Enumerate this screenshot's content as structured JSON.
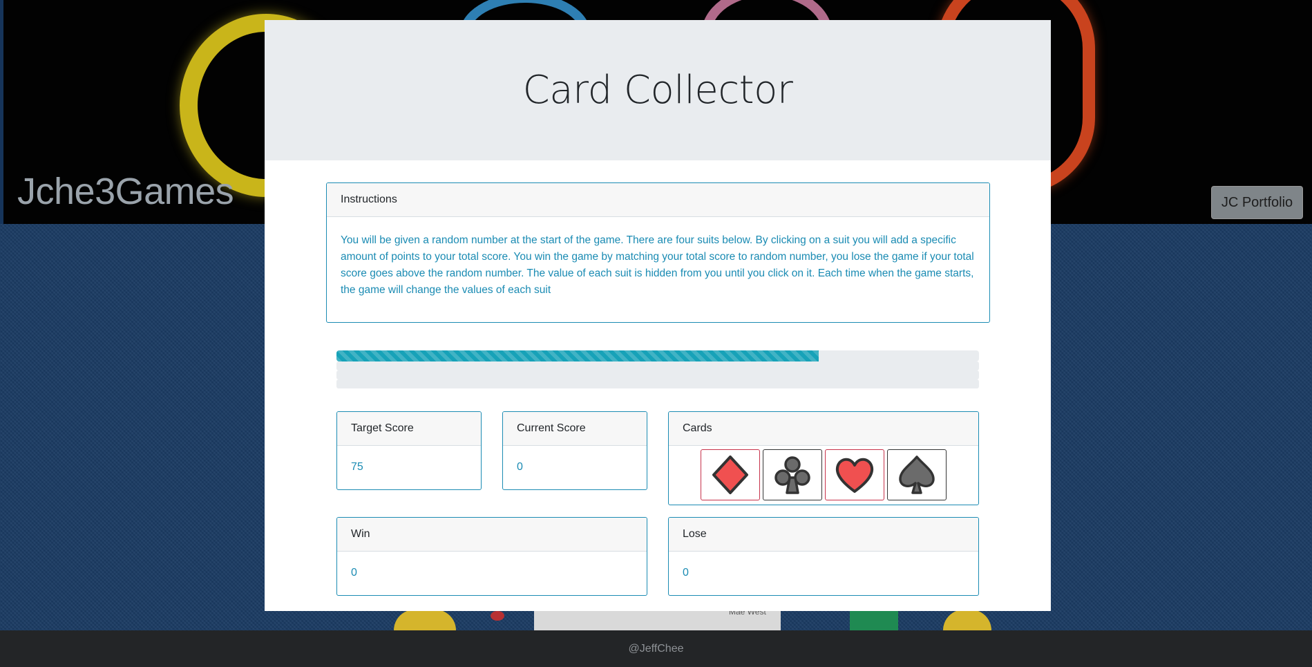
{
  "site": {
    "brand": "Jche3Games",
    "portfolio_button": "JC Portfolio",
    "footer": "@JeffChee",
    "decor_text": "Mae West"
  },
  "game": {
    "title": "Card Collector",
    "instructions_title": "Instructions",
    "instructions_text": "You will be given a random number at the start of the game. There are four suits below. By clicking on a suit you will add a specific amount of points to your total score. You win the game by matching your total score to random number, you lose the game if your total score goes above the random number. The value of each suit is hidden from you until you click on it. Each time when the game starts, the game will change the values of each suit",
    "progress_fraction": 0.75,
    "target_label": "Target Score",
    "target_value": "75",
    "current_label": "Current Score",
    "current_value": "0",
    "cards_label": "Cards",
    "suits": [
      {
        "name": "diamond-icon",
        "color": "#f05050"
      },
      {
        "name": "club-icon",
        "color": "#6b6b6b"
      },
      {
        "name": "heart-icon",
        "color": "#f05050"
      },
      {
        "name": "spade-icon",
        "color": "#6b6b6b"
      }
    ],
    "win_label": "Win",
    "win_value": "0",
    "lose_label": "Lose",
    "lose_value": "0"
  },
  "colors": {
    "accent": "#1a8bb3",
    "progress": "#17a2b8",
    "jumbotron": "#e9ecef"
  }
}
